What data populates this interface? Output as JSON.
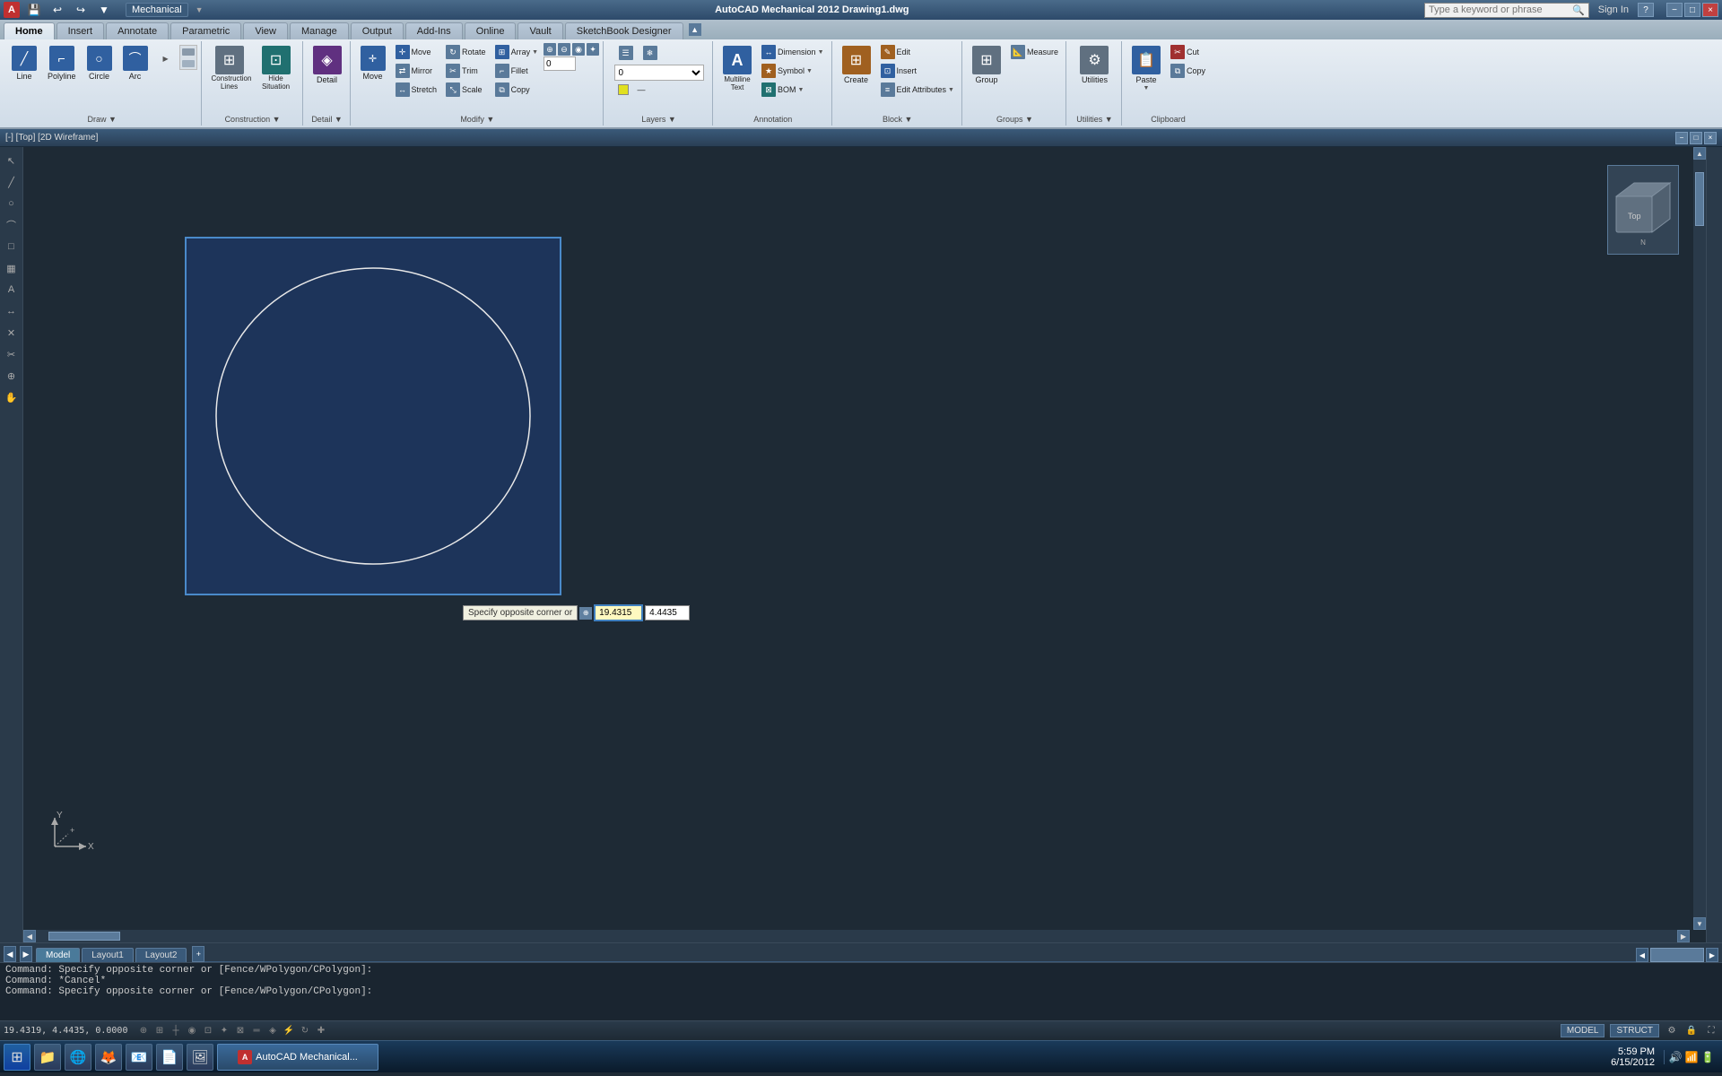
{
  "app": {
    "title": "AutoCAD Mechanical 2012 - Drawing1.dwg",
    "logo": "A",
    "workspace": "Mechanical"
  },
  "titlebar": {
    "quickaccess": [
      "save",
      "undo",
      "redo"
    ],
    "title": "AutoCAD Mechanical 2012  Drawing1.dwg",
    "workspace_label": "Mechanical",
    "signin": "Sign In",
    "search_placeholder": "Type a keyword or phrase",
    "close": "×",
    "minimize": "−",
    "restore": "□"
  },
  "ribbon": {
    "tabs": [
      "Home",
      "Insert",
      "Annotate",
      "Parametric",
      "View",
      "Manage",
      "Output",
      "Add-Ins",
      "Online",
      "Vault",
      "SketchBook Designer"
    ],
    "active_tab": "Home",
    "groups": {
      "draw": {
        "label": "Draw",
        "buttons": [
          "Line",
          "Polyline",
          "Circle",
          "Arc"
        ]
      },
      "construction": {
        "label": "Construction",
        "buttons": [
          "Construction Lines",
          "Hide Situation"
        ]
      },
      "detail": {
        "label": "Detail"
      },
      "modify": {
        "label": "Modify",
        "buttons": [
          "Move",
          "Rotate",
          "Array",
          "Mirror",
          "Trim",
          "Stretch",
          "Scale",
          "Fillet",
          "Copy"
        ]
      },
      "layers": {
        "label": "Layers"
      },
      "annotation": {
        "label": "Annotation",
        "buttons": [
          "Multiline Text",
          "Dimension",
          "Symbol",
          "BOM"
        ]
      },
      "block": {
        "label": "Block",
        "buttons": [
          "Create",
          "Edit",
          "Insert",
          "Edit Attributes"
        ]
      },
      "groups": {
        "label": "Groups",
        "buttons": [
          "Group",
          "Measure"
        ]
      },
      "utilities": {
        "label": "Utilities",
        "buttons": [
          "Paste"
        ]
      },
      "clipboard": {
        "label": "Clipboard",
        "buttons": [
          "Copy"
        ]
      }
    }
  },
  "viewport": {
    "label": "[-] [Top] [2D Wireframe]",
    "background_color": "#1e3a5a"
  },
  "coord_input": {
    "label": "Specify opposite corner or",
    "x_value": "19.4315",
    "y_value": "4.4435",
    "icon": "⊕"
  },
  "command_history": [
    "Command: Specify opposite corner or [Fence/WPolygon/CPolygon]:",
    "Command: *Cancel*",
    "",
    "Command: Specify opposite corner or [Fence/WPolygon/CPolygon]:"
  ],
  "statusbar": {
    "coords": "19.4319, 4.4435, 0.0000",
    "model_label": "MODEL",
    "date": "6/15/2012",
    "time": "5:59 PM",
    "layer": "STRUCT"
  },
  "layout_tabs": [
    "Model",
    "Layout1",
    "Layout2"
  ],
  "active_layout": "Model",
  "taskbar": {
    "start_label": "⊞",
    "apps": [
      "📁",
      "🌐",
      "🦊",
      "📧",
      "📄",
      "🖼"
    ],
    "time": "5:59 PM",
    "date": "6/15/2012"
  }
}
